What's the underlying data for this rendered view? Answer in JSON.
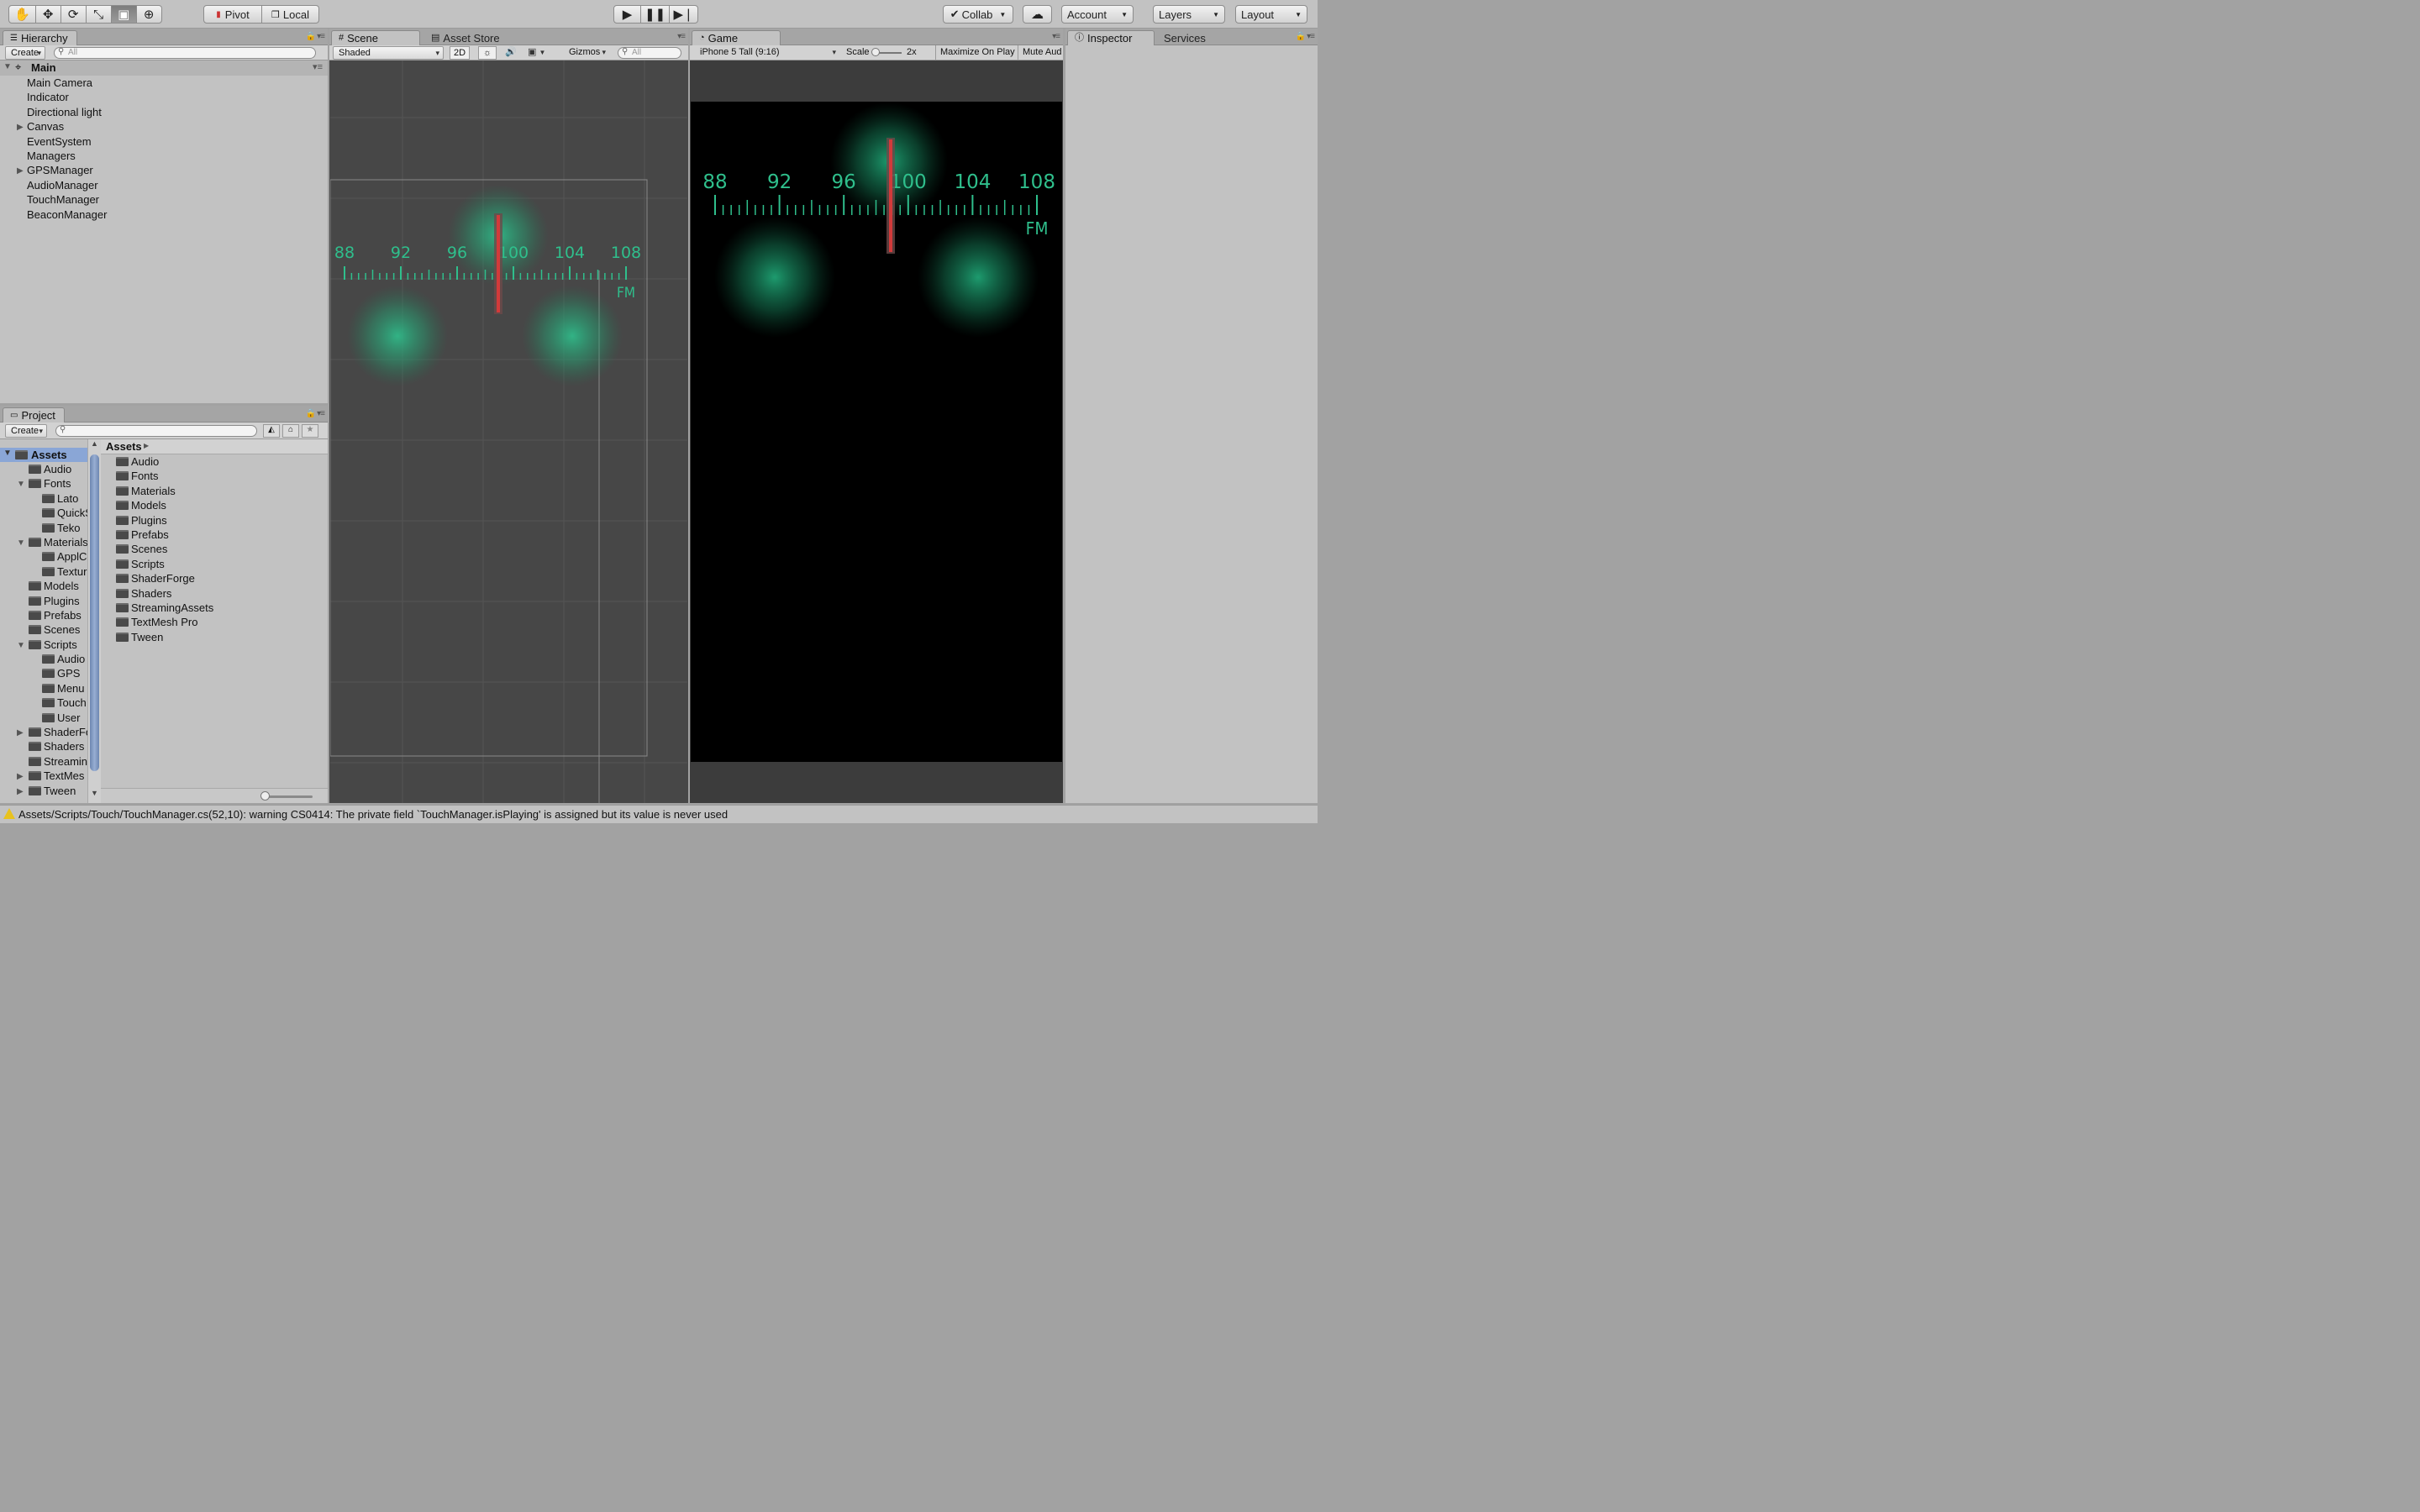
{
  "toolbar": {
    "pivot_label": "Pivot",
    "local_label": "Local",
    "collab_label": "Collab",
    "account_label": "Account",
    "layers_label": "Layers",
    "layout_label": "Layout",
    "tools": [
      "hand-icon",
      "move-icon",
      "rotate-icon",
      "scale-icon",
      "rect-tool-icon",
      "transform-icon"
    ]
  },
  "hierarchy": {
    "tab": "Hierarchy",
    "create": "Create",
    "search_placeholder": "All",
    "scene_name": "Main",
    "items": [
      {
        "label": "Main Camera",
        "expandable": false
      },
      {
        "label": "Indicator",
        "expandable": false
      },
      {
        "label": "Directional light",
        "expandable": false
      },
      {
        "label": "Canvas",
        "expandable": true
      },
      {
        "label": "EventSystem",
        "expandable": false
      },
      {
        "label": "Managers",
        "expandable": false
      },
      {
        "label": "GPSManager",
        "expandable": true
      },
      {
        "label": "AudioManager",
        "expandable": false
      },
      {
        "label": "TouchManager",
        "expandable": false
      },
      {
        "label": "BeaconManager",
        "expandable": false
      }
    ]
  },
  "project": {
    "tab": "Project",
    "create": "Create",
    "root": "Assets",
    "tree": [
      {
        "label": "Audio",
        "depth": 1,
        "arrow": ""
      },
      {
        "label": "Fonts",
        "depth": 1,
        "arrow": "open"
      },
      {
        "label": "Lato",
        "depth": 2,
        "arrow": ""
      },
      {
        "label": "QuickS",
        "depth": 2,
        "arrow": ""
      },
      {
        "label": "Teko",
        "depth": 2,
        "arrow": ""
      },
      {
        "label": "Materials",
        "depth": 1,
        "arrow": "open"
      },
      {
        "label": "ApplCo",
        "depth": 2,
        "arrow": ""
      },
      {
        "label": "Textur",
        "depth": 2,
        "arrow": ""
      },
      {
        "label": "Models",
        "depth": 1,
        "arrow": ""
      },
      {
        "label": "Plugins",
        "depth": 1,
        "arrow": ""
      },
      {
        "label": "Prefabs",
        "depth": 1,
        "arrow": ""
      },
      {
        "label": "Scenes",
        "depth": 1,
        "arrow": ""
      },
      {
        "label": "Scripts",
        "depth": 1,
        "arrow": "open"
      },
      {
        "label": "Audio",
        "depth": 2,
        "arrow": ""
      },
      {
        "label": "GPS",
        "depth": 2,
        "arrow": ""
      },
      {
        "label": "Menu",
        "depth": 2,
        "arrow": ""
      },
      {
        "label": "Touch",
        "depth": 2,
        "arrow": ""
      },
      {
        "label": "User",
        "depth": 2,
        "arrow": ""
      },
      {
        "label": "ShaderFo",
        "depth": 1,
        "arrow": "closed"
      },
      {
        "label": "Shaders",
        "depth": 1,
        "arrow": ""
      },
      {
        "label": "Streamin",
        "depth": 1,
        "arrow": ""
      },
      {
        "label": "TextMes",
        "depth": 1,
        "arrow": "closed"
      },
      {
        "label": "Tween",
        "depth": 1,
        "arrow": "closed"
      }
    ],
    "breadcrumb": "Assets",
    "folders": [
      "Audio",
      "Fonts",
      "Materials",
      "Models",
      "Plugins",
      "Prefabs",
      "Scenes",
      "Scripts",
      "ShaderForge",
      "Shaders",
      "StreamingAssets",
      "TextMesh Pro",
      "Tween"
    ]
  },
  "scene": {
    "tab": "Scene",
    "asset_store_tab": "Asset Store",
    "shading_mode": "Shaded",
    "mode_2d": "2D",
    "gizmos": "Gizmos",
    "search_placeholder": "All"
  },
  "game": {
    "tab": "Game",
    "resolution": "iPhone 5 Tall (9:16)",
    "scale_label": "Scale",
    "scale_value": "2x",
    "maximize_label": "Maximize On Play",
    "mute_label": "Mute Aud"
  },
  "dial": {
    "labels": [
      "88",
      "92",
      "96",
      "100",
      "104",
      "108"
    ],
    "band": "FM",
    "accent_color": "#2fbf8c",
    "needle_color": "#d23a3a"
  },
  "inspector": {
    "tab": "Inspector",
    "services_tab": "Services"
  },
  "status": {
    "message": "Assets/Scripts/Touch/TouchManager.cs(52,10): warning CS0414: The private field `TouchManager.isPlaying' is assigned but its value is never used"
  }
}
